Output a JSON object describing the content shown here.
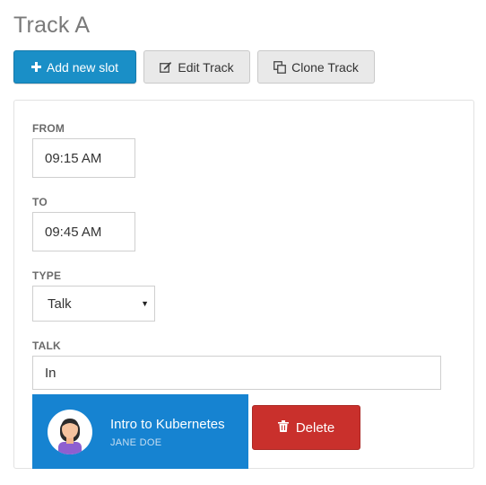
{
  "page": {
    "title": "Track A"
  },
  "toolbar": {
    "add_slot_label": "Add new slot",
    "edit_track_label": "Edit Track",
    "clone_track_label": "Clone Track"
  },
  "form": {
    "from": {
      "label": "FROM",
      "value": "09:15 AM"
    },
    "to": {
      "label": "TO",
      "value": "09:45 AM"
    },
    "type": {
      "label": "TYPE",
      "selected": "Talk"
    },
    "talk": {
      "label": "TALK",
      "value": "In"
    }
  },
  "search_result": {
    "title": "Intro to Kubernetes",
    "speaker": "JANE DOE"
  },
  "delete_label": "Delete",
  "colors": {
    "primary": "#1a8fc7",
    "result_bg": "#1683d1",
    "danger": "#c9302c"
  }
}
